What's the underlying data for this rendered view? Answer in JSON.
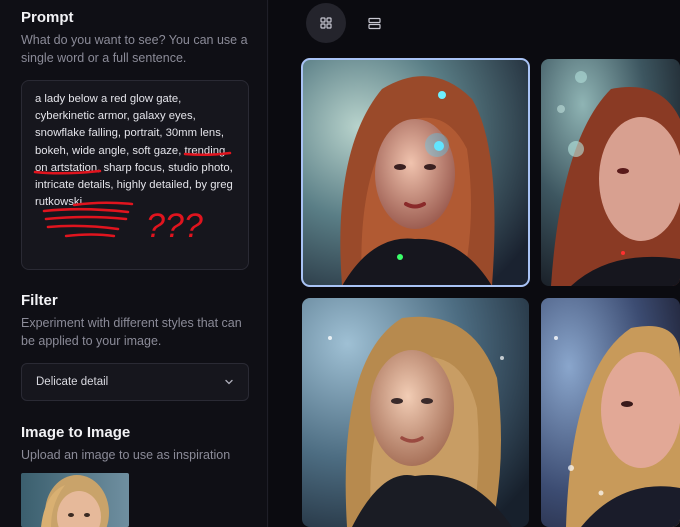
{
  "sidebar": {
    "prompt": {
      "title": "Prompt",
      "description": "What do you want to see? You can use a single word or a full sentence.",
      "text": "a lady below a red glow gate, cyberkinetic armor, galaxy eyes, snowflake falling, portrait, 30mm lens, bokeh, wide angle, soft gaze, trending on artstation, sharp focus, studio photo, intricate details, highly detailed, by greg rutkowski",
      "annotation": "???"
    },
    "filter": {
      "title": "Filter",
      "description": "Experiment with different styles that can be applied to your image.",
      "selected": "Delicate detail"
    },
    "image_to_image": {
      "title": "Image to Image",
      "description": "Upload an image to use as inspiration"
    }
  },
  "toolbar": {
    "grid_view_icon": "grid-view-icon",
    "list_view_icon": "list-view-icon"
  },
  "colors": {
    "accent_selected": "#a9c3f5",
    "scribble_red": "#e0141e"
  }
}
